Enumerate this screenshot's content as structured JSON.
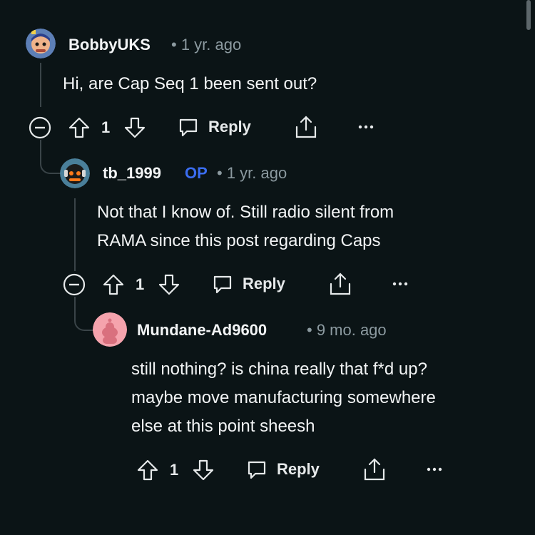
{
  "comments": [
    {
      "username": "BobbyUKS",
      "time": "• 1 yr. ago",
      "text": "Hi, are Cap Seq 1 been sent out?",
      "votes": "1",
      "reply_label": "Reply"
    },
    {
      "username": "tb_1999",
      "op_badge": "OP",
      "time": "• 1 yr. ago",
      "text_lines": [
        "Not that I know of. Still radio silent from",
        "RAMA since this post regarding Caps"
      ],
      "votes": "1",
      "reply_label": "Reply"
    },
    {
      "username": "Mundane-Ad9600",
      "time": "• 9 mo. ago",
      "text_lines": [
        "still nothing? is china really that f*d up?",
        "maybe move manufacturing somewhere",
        "else at this point sheesh"
      ],
      "votes": "1",
      "reply_label": "Reply"
    }
  ],
  "icons": {
    "collapse": "minus-circle-icon",
    "upvote": "arrow-up-icon",
    "downvote": "arrow-down-icon",
    "reply": "speech-bubble-icon",
    "share": "share-icon",
    "more": "ellipsis-icon"
  },
  "colors": {
    "background": "#0b1416",
    "op_badge": "#3b6df0",
    "meta": "#8c9aa0",
    "mundane_avatar": "#f5a3ad"
  }
}
